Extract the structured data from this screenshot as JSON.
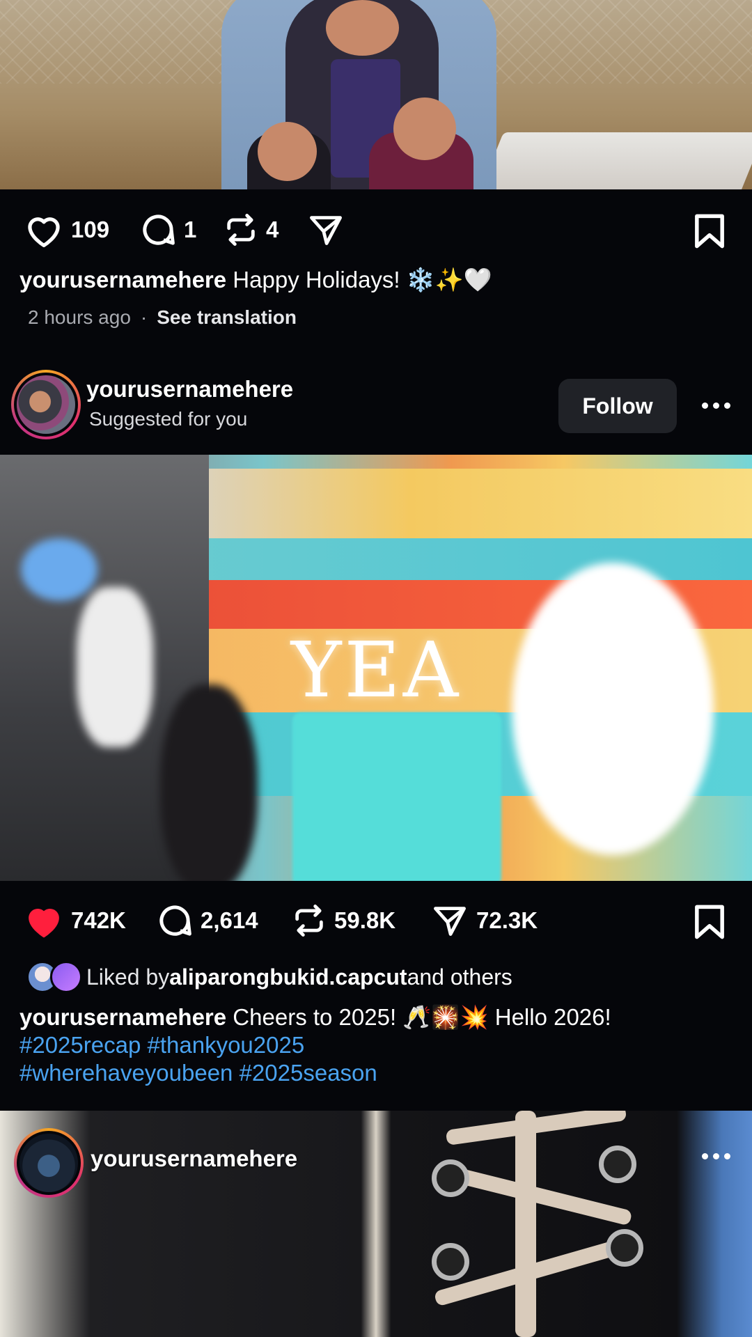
{
  "post1": {
    "actions": {
      "likes": "109",
      "comments": "1",
      "reposts": "4"
    },
    "caption_user": "yourusernamehere",
    "caption_text": " Happy Holidays! ❄️✨🤍",
    "time_ago": "2 hours ago",
    "separator": "·",
    "translate_label": "See translation"
  },
  "post2": {
    "username": "yourusernamehere",
    "subtitle": "Suggested for you",
    "follow_label": "Follow",
    "overlay_text": "YEA",
    "actions": {
      "likes": "742K",
      "comments": "2,614",
      "reposts": "59.8K",
      "shares": "72.3K"
    },
    "liked_by_prefix": "Liked by",
    "liked_by_user": "aliparongbukid.capcut",
    "liked_by_suffix": " and others",
    "caption_user": "yourusernamehere",
    "caption_text": " Cheers to 2025! 🥂🎇💥 Hello 2026!",
    "hashtags_line1": "#2025recap #thankyou2025",
    "hashtags_line2": "#wherehaveyoubeen #2025season"
  },
  "post3": {
    "username": "yourusernamehere"
  },
  "colors": {
    "background": "#05060a",
    "like_active": "#ff1f3d",
    "hashtag": "#4aa3f0",
    "follow_button_bg": "#202227"
  },
  "icons": [
    "heart-icon",
    "comment-icon",
    "repost-icon",
    "share-icon",
    "bookmark-icon",
    "more-icon"
  ]
}
